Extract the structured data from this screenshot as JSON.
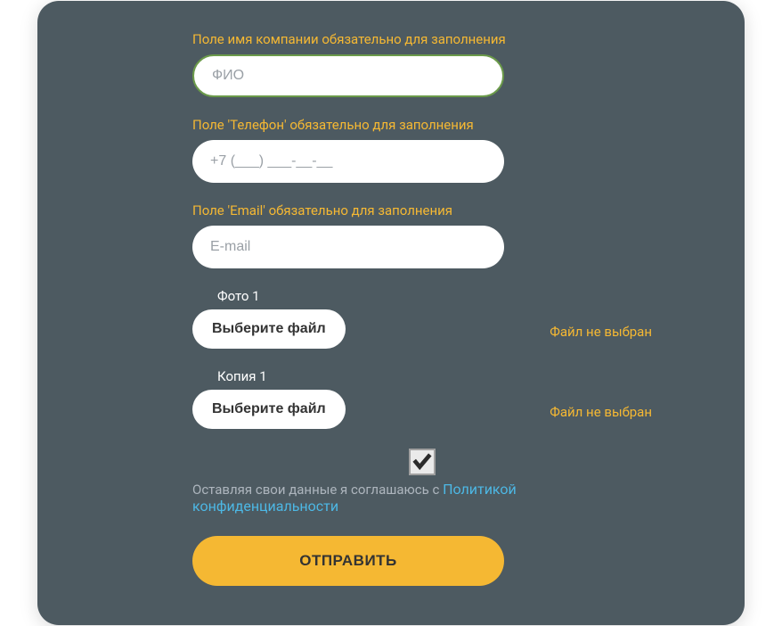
{
  "errors": {
    "company_name": "Поле имя компании обязательно для заполнения",
    "phone": "Поле 'Телефон' обязательно для заполнения",
    "email": "Поле 'Email' обязательно для заполнения"
  },
  "placeholders": {
    "name": "ФИО",
    "phone": "+7 (___) ___-__-__",
    "email": "E-mail"
  },
  "file1": {
    "label": "Фото 1",
    "button": "Выберите файл",
    "status": "Файл не выбран"
  },
  "file2": {
    "label": "Копия 1",
    "button": "Выберите файл",
    "status": "Файл не выбран"
  },
  "consent": {
    "text": "Оставляя свои данные я соглашаюсь с ",
    "link": "Политикой конфиденциальности"
  },
  "submit": "ОТПРАВИТЬ"
}
